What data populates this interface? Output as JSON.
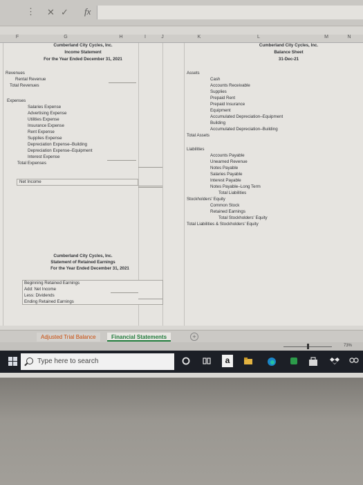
{
  "formula_bar": {
    "cancel_glyph": "✕",
    "enter_glyph": "✓",
    "fx_label": "fx",
    "menu_glyph": "⋮"
  },
  "columns": [
    "F",
    "G",
    "H",
    "I",
    "J",
    "K",
    "L",
    "M",
    "N"
  ],
  "income_statement": {
    "company": "Cumberland City Cycles, Inc.",
    "title": "Income Statement",
    "period": "For the Year Ended December 31, 2021",
    "revenues": "Revenues",
    "rental_revenue": "Rental Revenue",
    "total_revenues": "Total Revenues",
    "expenses": "Expenses",
    "expense_items": [
      "Salaries Expense",
      "Advertising Expense",
      "Utilities Expense",
      "Insurance Expense",
      "Rent Expense",
      "Supplies Expense",
      "Depreciation Expense–Building",
      "Depreciation Expense–Equipment",
      "Interest Expense"
    ],
    "total_expenses": "Total Expenses",
    "net_income": "Net Income"
  },
  "balance_sheet": {
    "company": "Cumberland City Cycles, Inc.",
    "title": "Balance Sheet",
    "date": "31-Dec-21",
    "assets": "Assets",
    "asset_items": [
      "Cash",
      "Accounts Receivable",
      "Supplies",
      "Prepaid Rent",
      "Prepaid Insurance",
      "Equipment",
      "Accumulated Depreciation–Equipment",
      "Building",
      "Accumulated Depreciation–Building"
    ],
    "total_assets": "Total Assets",
    "liabilities": "Liabilities",
    "liability_items": [
      "Accounts Payable",
      "Unearned Revenue",
      "Notes Payable",
      "Salaries Payable",
      "Interest Payable",
      "Notes Payable–Long Term"
    ],
    "total_liabilities": "Total Liabilities",
    "equity": "Stockholders' Equity",
    "equity_items": [
      "Common Stock",
      "Retained Earnings"
    ],
    "total_equity": "Total Stockholders' Equity",
    "total_liabilities_equity": "Total Liabilities & Stockholders' Equity"
  },
  "retained_earnings": {
    "company": "Cumberland City Cycles, Inc.",
    "title": "Statement of Retained Earnings",
    "period": "For the Year Ended December 31, 2021",
    "beginning": "Beginning Retained Earnings",
    "add": "Add: Net Income",
    "less": "Less: Dividends",
    "ending": "Ending Retained Earnings"
  },
  "sheet_tabs": [
    "Adjusted Trial Balance",
    "Financial Statements"
  ],
  "active_tab": "Financial Statements",
  "add_sheet_glyph": "+",
  "zoom": "73%",
  "taskbar": {
    "search_placeholder": "Type here to search",
    "amazon_glyph": "a"
  }
}
